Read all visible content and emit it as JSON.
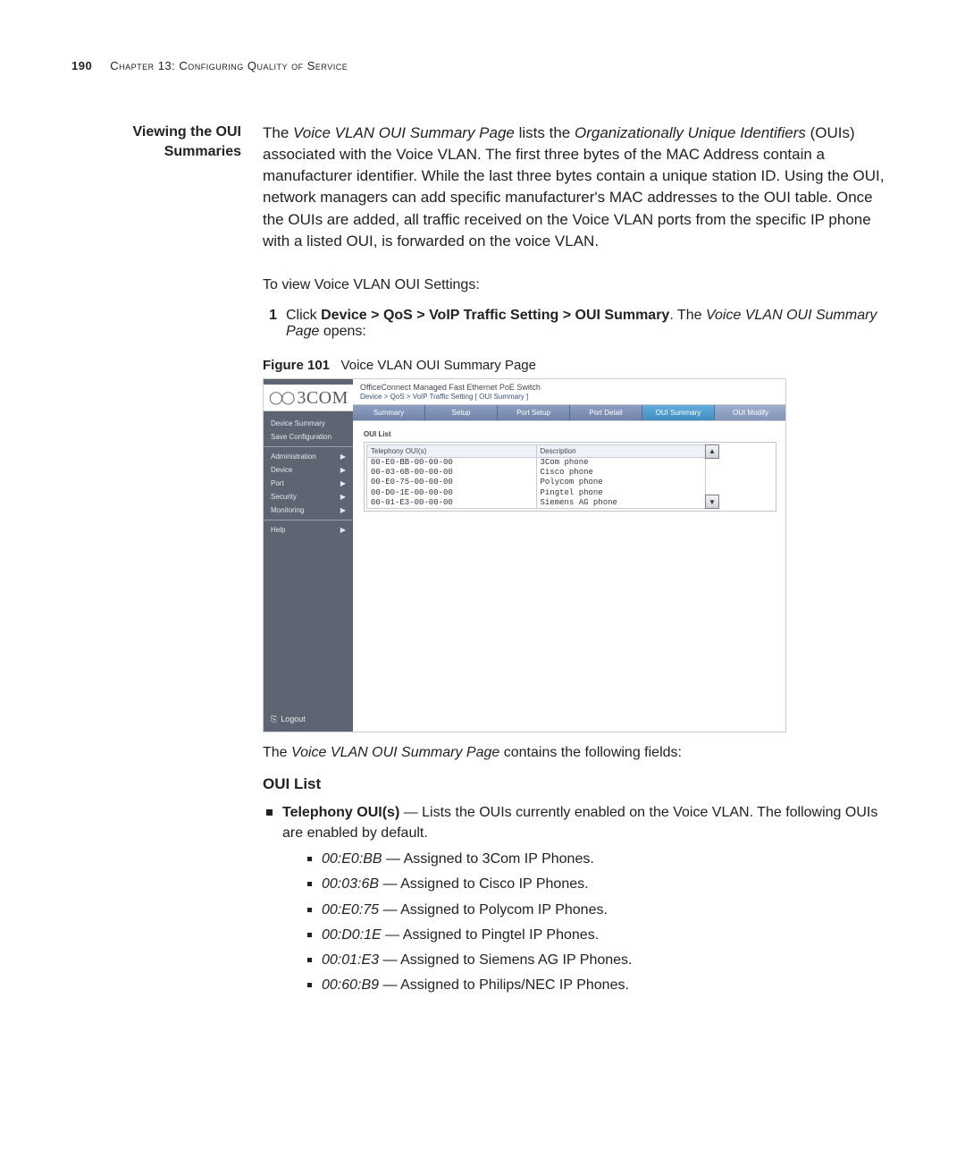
{
  "header": {
    "page_number": "190",
    "chapter": "Chapter 13: Configuring Quality of Service"
  },
  "section": {
    "side_heading_l1": "Viewing the OUI",
    "side_heading_l2": "Summaries"
  },
  "intro": {
    "p1a": "The ",
    "p1b": "Voice VLAN OUI Summary Page",
    "p1c": " lists the ",
    "p1d": "Organizationally Unique Identifiers",
    "p1e": " (OUIs) associated with the Voice VLAN. The first three bytes of the MAC Address contain a manufacturer identifier. While the last three bytes contain a unique station ID. Using the OUI, network managers can add specific manufacturer's MAC addresses to the OUI table. Once the OUIs are added, all traffic received on the Voice VLAN ports from the specific IP phone with a listed OUI, is forwarded on the voice VLAN.",
    "p2": "To view Voice VLAN OUI Settings:"
  },
  "step": {
    "num": "1",
    "a": "Click ",
    "b": "Device > QoS > VoIP Traffic Setting > OUI Summary",
    "c": ". The ",
    "d": "Voice VLAN OUI Summary Page",
    "e": " opens:"
  },
  "figure": {
    "label": "Figure 101",
    "title": "Voice VLAN OUI Summary Page"
  },
  "shot": {
    "logo_text": "3COM",
    "product": "OfficeConnect Managed Fast Ethernet PoE Switch",
    "breadcrumb": "Device > QoS > VoIP Traffic Setting [ OUI Summary ]",
    "nav": {
      "device_summary": "Device Summary",
      "save_configuration": "Save Configuration",
      "administration": "Administration",
      "device": "Device",
      "port": "Port",
      "security": "Security",
      "monitoring": "Monitoring",
      "help": "Help",
      "logout": "Logout"
    },
    "tabs": {
      "summary": "Summary",
      "setup": "Setup",
      "port_setup": "Port Setup",
      "port_detail": "Port Detail",
      "oui_summary": "OUI Summary",
      "oui_modify": "OUI Modify"
    },
    "panel_label": "OUI List",
    "table": {
      "col_oui": "Telephony OUI(s)",
      "col_desc": "Description",
      "rows": [
        {
          "oui": "00-E0-BB-00-00-00",
          "desc": "3Com phone"
        },
        {
          "oui": "00-03-6B-00-00-00",
          "desc": "Cisco phone"
        },
        {
          "oui": "00-E0-75-00-00-00",
          "desc": "Polycom phone"
        },
        {
          "oui": "00-D0-1E-00-00-00",
          "desc": "Pingtel phone"
        },
        {
          "oui": "00-01-E3-00-00-00",
          "desc": "Siemens AG phone"
        }
      ]
    }
  },
  "after": {
    "lead_a": "The ",
    "lead_b": "Voice VLAN OUI Summary Page",
    "lead_c": " contains the following fields:",
    "h4": "OUI List",
    "oui_field_label": "Telephony OUI(s)",
    "oui_field_desc": " — Lists the OUIs currently enabled on the Voice VLAN. The following OUIs are enabled by default.",
    "defaults": [
      {
        "code": "00:E0:BB",
        "desc": " — Assigned to 3Com IP Phones."
      },
      {
        "code": "00:03:6B",
        "desc": " — Assigned to Cisco IP Phones."
      },
      {
        "code": "00:E0:75",
        "desc": " — Assigned to Polycom IP Phones."
      },
      {
        "code": "00:D0:1E",
        "desc": " — Assigned to Pingtel IP Phones."
      },
      {
        "code": "00:01:E3",
        "desc": " — Assigned to Siemens AG IP Phones."
      },
      {
        "code": "00:60:B9",
        "desc": " — Assigned to Philips/NEC IP Phones."
      }
    ]
  }
}
